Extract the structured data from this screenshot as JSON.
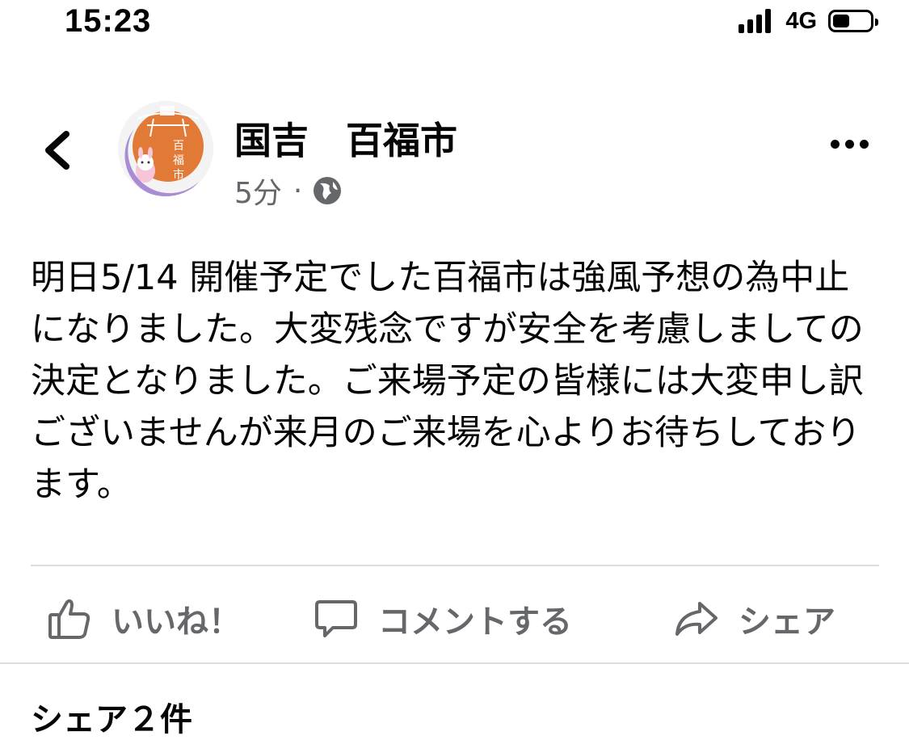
{
  "status_bar": {
    "time": "15:23",
    "network": "4G",
    "signal_bars": 4,
    "battery_level": 0.45
  },
  "post": {
    "page_name": "国吉　百福市",
    "time_ago": "5分",
    "separator": "·",
    "privacy_icon": "globe-icon",
    "avatar_text": "百福市",
    "text": "明日5/14 開催予定でした百福市は強風予想の為中止になりました。大変残念ですが安全を考慮しましての決定となりました。ご来場予定の皆様には大変申し訳ございませんが来月のご来場を心よりお待ちしております。"
  },
  "actions": {
    "like": "いいね！",
    "comment": "コメントする",
    "share": "シェア"
  },
  "footer": {
    "share_count": "シェア２件"
  },
  "colors": {
    "primary_text": "#050505",
    "secondary_text": "#65676b",
    "divider": "#dadde1",
    "avatar_orange": "#e07a36",
    "avatar_purple": "#a98bd6"
  }
}
